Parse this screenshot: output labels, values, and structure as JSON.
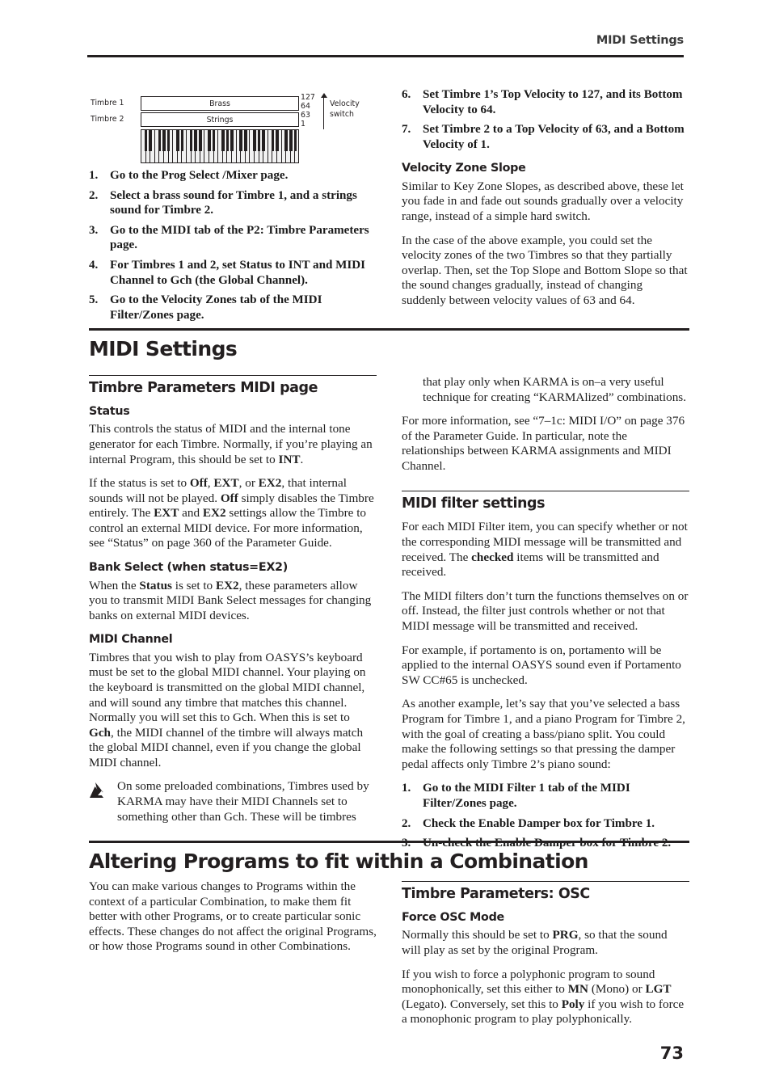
{
  "running_head": "MIDI Settings",
  "page_number": "73",
  "figure": {
    "timbre1_label": "Timbre 1",
    "timbre2_label": "Timbre 2",
    "band1_text": "Brass",
    "band2_text": "Strings",
    "scale_top": "127",
    "scale_upper_mid": "64",
    "scale_lower_mid": "63",
    "scale_bottom": "1",
    "arrow_label_line1": "Velocity",
    "arrow_label_line2": "switch"
  },
  "steps_left": [
    {
      "num": "1.",
      "text": "Go to the Prog Select /Mixer page."
    },
    {
      "num": "2.",
      "text": "Select a brass sound for Timbre 1, and a strings sound for Timbre 2."
    },
    {
      "num": "3.",
      "text": "Go to the MIDI tab of the P2: Timbre Parameters page."
    },
    {
      "num": "4.",
      "text": "For Timbres 1 and 2, set Status to INT and MIDI Channel to Gch (the Global Channel)."
    },
    {
      "num": "5.",
      "text": "Go to the Velocity Zones tab of the MIDI Filter/Zones page."
    }
  ],
  "steps_right": [
    {
      "num": "6.",
      "text": "Set Timbre 1’s Top Velocity to 127, and its Bottom Velocity to 64."
    },
    {
      "num": "7.",
      "text": "Set Timbre 2 to a Top Velocity of 63, and a Bottom Velocity of 1."
    }
  ],
  "velocity_zone_slope": {
    "heading": "Velocity Zone Slope",
    "p1": "Similar to Key Zone Slopes, as described above, these let you fade in and fade out sounds gradually over a velocity range, instead of a simple hard switch.",
    "p2": "In the case of the above example, you could set the velocity zones of the two Timbres so that they partially overlap. Then, set the Top Slope and Bottom Slope so that the sound changes gradually, instead of changing suddenly between velocity values of 63 and 64."
  },
  "midi_settings": {
    "h1": "MIDI Settings",
    "h2_timbre_params": "Timbre Parameters MIDI page",
    "status": {
      "heading": "Status",
      "p1_a": "This controls the status of MIDI and the internal tone generator for each Timbre. Normally, if you’re playing an internal Program, this should be set to ",
      "p1_b": "INT",
      "p1_c": ".",
      "p2_a": "If the status is set to ",
      "p2_off": "Off",
      "p2_b": ", ",
      "p2_ext": "EXT",
      "p2_c": ", or ",
      "p2_ex2": "EX2",
      "p2_d": ", that internal sounds will not be played. ",
      "p2_off2": "Off",
      "p2_e": " simply disables the Timbre entirely. The ",
      "p2_ext2": "EXT",
      "p2_f": " and ",
      "p2_ex22": "EX2",
      "p2_g": " settings allow the Timbre to control an external MIDI device. For more information, see “Status” on page 360 of the Parameter Guide."
    },
    "bank_select": {
      "heading": "Bank Select (when status=EX2)",
      "p1_a": "When the ",
      "p1_status": "Status",
      "p1_b": " is set to ",
      "p1_ex2": "EX2",
      "p1_c": ", these parameters allow you to transmit MIDI Bank Select messages for changing banks on external MIDI devices."
    },
    "midi_channel": {
      "heading": "MIDI Channel",
      "p1_a": "Timbres that you wish to play from OASYS’s keyboard must be set to the global MIDI channel. Your playing on the keyboard is transmitted on the global MIDI channel, and will sound any timbre that matches this channel. Normally you will set this to Gch. When this is set to ",
      "p1_gch": "Gch",
      "p1_b": ", the MIDI channel of the timbre will always match the global MIDI channel, even if you change the global MIDI channel."
    },
    "note": {
      "icon": "note-pointer-icon",
      "text": "On some preloaded combinations, Timbres used by KARMA may have their MIDI Channels set to something other than Gch. These will be timbres"
    },
    "note_continued": "that play only when KARMA is on–a very useful technique for creating “KARMAlized” combinations.",
    "more_info": "For more information, see “7–1c: MIDI I/O” on page 376 of the Parameter Guide. In particular, note the relationships between KARMA assignments and MIDI Channel."
  },
  "midi_filter": {
    "h2": "MIDI filter settings",
    "p1_a": "For each MIDI Filter item, you can specify whether or not the corresponding MIDI message will be transmitted and received. The ",
    "p1_checked": "checked",
    "p1_b": " items will be transmitted and received.",
    "p2": "The MIDI filters don’t turn the functions themselves on or off. Instead, the filter just controls whether or not that MIDI message will be transmitted and received.",
    "p3": "For example, if portamento is on, portamento will be applied to the internal OASYS sound even if Portamento SW CC#65 is unchecked.",
    "p4": "As another example, let’s say that you’ve selected a bass Program for Timbre 1, and a piano Program for Timbre 2, with the goal of creating a bass/piano split. You could make the following settings so that pressing the damper pedal affects only Timbre 2’s piano sound:",
    "steps": [
      {
        "num": "1.",
        "text": "Go to the MIDI Filter 1 tab of the MIDI Filter/Zones page."
      },
      {
        "num": "2.",
        "text": "Check the Enable Damper box for Timbre 1."
      },
      {
        "num": "3.",
        "text": "Un-check the Enable Damper box for Timbre 2."
      }
    ]
  },
  "altering": {
    "h1": "Altering Programs to fit within a Combination",
    "intro": "You can make various changes to Programs within the context of a particular Combination, to make them fit better with other Programs, or to create particular sonic effects. These changes do not affect the original Programs, or how those Programs sound in other Combinations.",
    "h2_osc": "Timbre Parameters: OSC",
    "force_osc": {
      "heading": "Force OSC Mode",
      "p1_a": "Normally this should be set to ",
      "p1_prg": "PRG",
      "p1_b": ", so that the sound will play as set by the original Program.",
      "p2_a": "If you wish to force a polyphonic program to sound monophonically, set this either to ",
      "p2_mn": "MN",
      "p2_b": " (Mono) or ",
      "p2_lgt": "LGT",
      "p2_c": " (Legato). Conversely, set this to ",
      "p2_poly": "Poly",
      "p2_d": " if you wish to force a monophonic program to play polyphonically."
    }
  },
  "colors": {
    "ink": "#231f20",
    "body": "#1f1f1f",
    "runhead": "#3a3a3a"
  }
}
